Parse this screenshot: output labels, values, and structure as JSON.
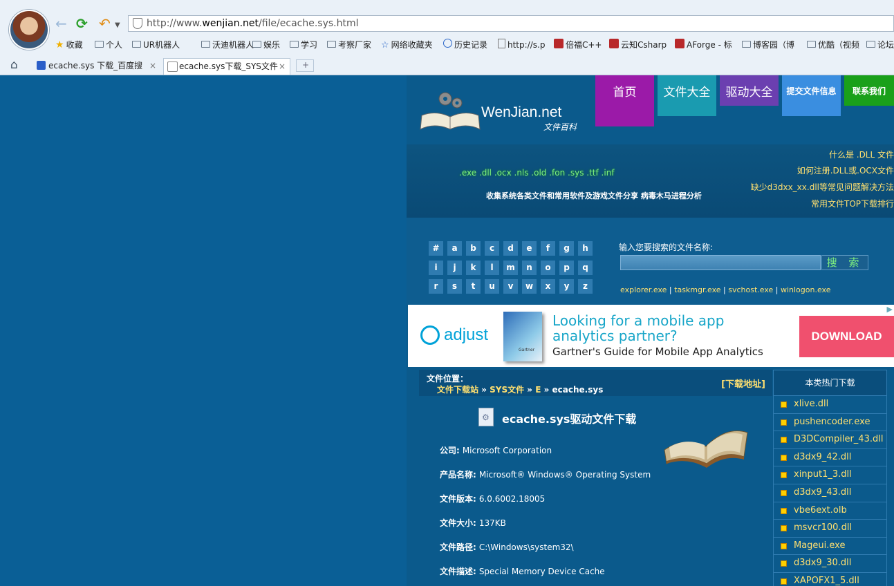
{
  "browser": {
    "url_prefix": "http://www.",
    "url_host": "wenjian.net",
    "url_path": "/file/ecache.sys.html",
    "bookmarks": [
      {
        "label": "收藏",
        "icon": "star-icon"
      },
      {
        "label": "个人",
        "icon": "folder-icon"
      },
      {
        "label": "UR机器人",
        "icon": "folder-icon"
      },
      {
        "label": "沃迪机器人",
        "icon": "folder-icon"
      },
      {
        "label": "娱乐",
        "icon": "folder-icon"
      },
      {
        "label": "学习",
        "icon": "folder-icon"
      },
      {
        "label": "考察厂家",
        "icon": "folder-icon"
      },
      {
        "label": "网络收藏夹",
        "icon": "star-outline-icon"
      },
      {
        "label": "历史记录",
        "icon": "clock-icon"
      },
      {
        "label": "http://s.p",
        "icon": "page-icon"
      },
      {
        "label": "倍福C++",
        "icon": "site-icon"
      },
      {
        "label": "云知Csharp",
        "icon": "site-icon"
      },
      {
        "label": "AForge - 标",
        "icon": "site-icon"
      },
      {
        "label": "博客园（博",
        "icon": "folder-icon"
      },
      {
        "label": "优酷（视频",
        "icon": "folder-icon"
      },
      {
        "label": "论坛",
        "icon": "folder-icon"
      }
    ],
    "tabs": [
      {
        "label": "ecache.sys 下载_百度搜",
        "close": "×"
      },
      {
        "label": "ecache.sys下载_SYS文件",
        "close": "×"
      }
    ],
    "new_tab": "+"
  },
  "site": {
    "logo_text": "WenJian.net",
    "logo_sub": "文件百科",
    "nav": [
      "首页",
      "文件大全",
      "驱动大全",
      "提交文件信息",
      "联系我们"
    ],
    "nav_colors": [
      "#9b1aa8",
      "#1a9bb0",
      "#6b3fb0",
      "#3a8ee0",
      "#1aa01a"
    ],
    "extensions": ".exe .dll .ocx .nls .old .fon .sys .ttf .inf",
    "tagline": "收集系统各类文件和常用软件及游戏文件分享 病毒木马进程分析",
    "right_links": [
      "什么是 .DLL 文件",
      "如何注册.DLL或.OCX文件",
      "缺少d3dxx_xx.dll等常见问题解决方法",
      "常用文件TOP下载排行"
    ],
    "letters": [
      "#",
      "a",
      "b",
      "c",
      "d",
      "e",
      "f",
      "g",
      "h",
      "i",
      "j",
      "k",
      "l",
      "m",
      "n",
      "o",
      "p",
      "q",
      "r",
      "s",
      "t",
      "u",
      "v",
      "w",
      "x",
      "y",
      "z"
    ],
    "search_label": "输入您要搜索的文件名称:",
    "search_button": "搜 索",
    "quick_links": [
      "explorer.exe",
      "taskmgr.exe",
      "svchost.exe",
      "winlogon.exe"
    ],
    "quick_sep": " | "
  },
  "ad": {
    "brand": "adjust",
    "box_brand": "Gartner",
    "headline_line1": "Looking for a mobile app",
    "headline_line2": "analytics partner?",
    "sub": "Gartner's Guide for Mobile App Analytics",
    "button": "DOWNLOAD"
  },
  "file": {
    "location_label": "文件位置：",
    "crumbs": [
      "文件下载站",
      "SYS文件",
      "E",
      "ecache.sys"
    ],
    "crumb_sep": " » ",
    "download_link": "[下载地址]",
    "title": "ecache.sys驱动文件下载",
    "fields": [
      {
        "label": "公司:",
        "value": "Microsoft Corporation"
      },
      {
        "label": "产品名称:",
        "value": "Microsoft® Windows® Operating System"
      },
      {
        "label": "文件版本:",
        "value": "6.0.6002.18005"
      },
      {
        "label": "文件大小:",
        "value": "137KB"
      },
      {
        "label": "文件路径:",
        "value": "C:\\Windows\\system32\\"
      },
      {
        "label": "文件描述:",
        "value": "Special Memory Device Cache"
      }
    ]
  },
  "sidebar": {
    "title": "本类热门下载",
    "items": [
      "xlive.dll",
      "pushencoder.exe",
      "D3DCompiler_43.dll",
      "d3dx9_42.dll",
      "xinput1_3.dll",
      "d3dx9_43.dll",
      "vbe6ext.olb",
      "msvcr100.dll",
      "Mageui.exe",
      "d3dx9_30.dll",
      "XAPOFX1_5.dll"
    ]
  }
}
